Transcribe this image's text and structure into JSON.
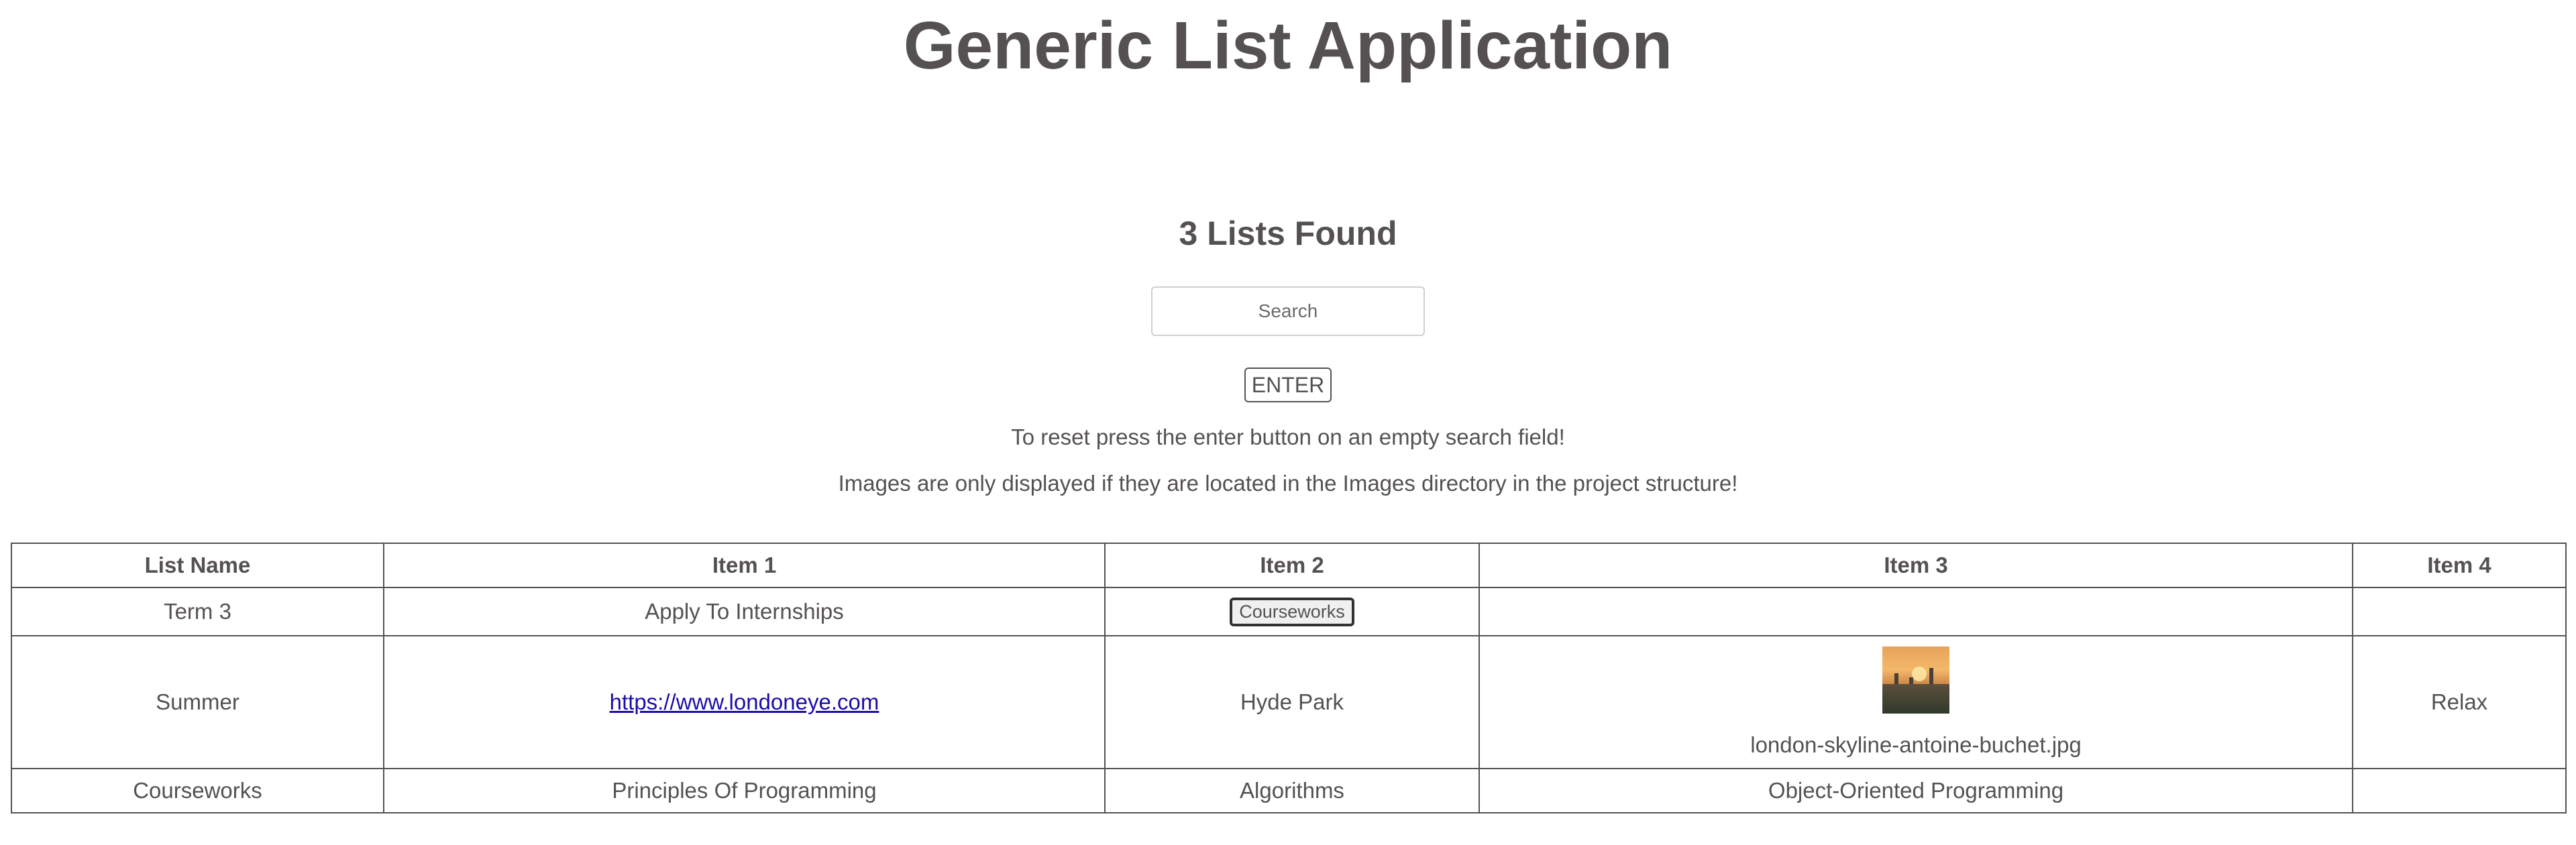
{
  "header": {
    "title": "Generic List Application"
  },
  "summary": {
    "lists_found": "3 Lists Found"
  },
  "search": {
    "placeholder": "Search",
    "value": "",
    "enter_label": "ENTER"
  },
  "hints": [
    "To reset press the enter button on an empty search field!",
    "Images are only displayed if they are located in the Images directory in the project structure!"
  ],
  "table": {
    "columns": [
      "List Name",
      "Item 1",
      "Item 2",
      "Item 3",
      "Item 4"
    ],
    "rows": [
      {
        "list_name": "Term 3",
        "item1": "Apply To Internships",
        "item2_button": "Courseworks",
        "item3": "",
        "item4": ""
      },
      {
        "list_name": "Summer",
        "item1_link": "https://www.londoneye.com",
        "item2": "Hyde Park",
        "item3_image_caption": "london-skyline-antoine-buchet.jpg",
        "item4": "Relax"
      },
      {
        "list_name": "Courseworks",
        "item1": "Principles Of Programming",
        "item2": "Algorithms",
        "item3": "Object-Oriented Programming",
        "item4": ""
      }
    ]
  },
  "colors": {
    "text": "#555152",
    "link": "#1a0dab",
    "border": "#555152"
  }
}
